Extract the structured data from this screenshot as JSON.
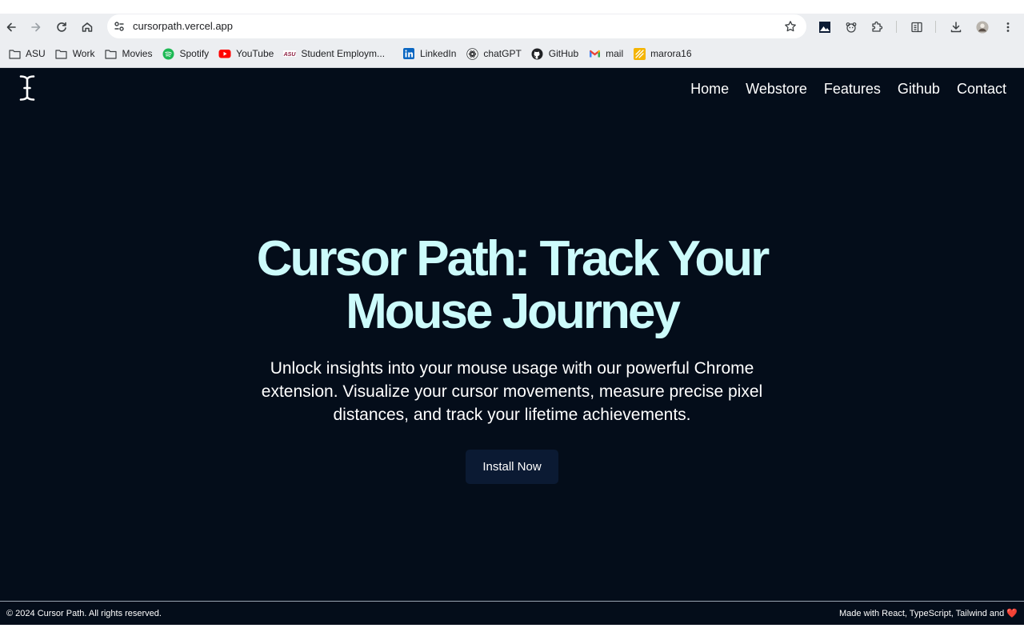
{
  "browser": {
    "url": "cursorpath.vercel.app",
    "bookmarks": [
      {
        "label": "ASU",
        "icon": "folder-icon"
      },
      {
        "label": "Work",
        "icon": "folder-icon"
      },
      {
        "label": "Movies",
        "icon": "folder-icon"
      },
      {
        "label": "Spotify",
        "icon": "spotify-icon",
        "color": "#1db954"
      },
      {
        "label": "YouTube",
        "icon": "youtube-icon",
        "color": "#ff0000"
      },
      {
        "label": "Student Employm...",
        "icon": "asu-icon",
        "color": "#8c1d40"
      },
      {
        "label": "LinkedIn",
        "icon": "linkedin-icon",
        "color": "#0a66c2"
      },
      {
        "label": "chatGPT",
        "icon": "chatgpt-icon"
      },
      {
        "label": "GitHub",
        "icon": "github-icon"
      },
      {
        "label": "mail",
        "icon": "gmail-icon",
        "color": "#ea4335"
      },
      {
        "label": "marora16",
        "icon": "marora-icon",
        "color": "#f4b400"
      }
    ]
  },
  "site": {
    "nav": [
      "Home",
      "Webstore",
      "Features",
      "Github",
      "Contact"
    ],
    "hero": {
      "title": "Cursor Path: Track Your Mouse Journey",
      "subtitle": "Unlock insights into your mouse usage with our powerful Chrome extension. Visualize your cursor movements, measure precise pixel distances, and track your lifetime achievements.",
      "cta": "Install Now"
    },
    "footer": {
      "copyright": "© 2024 Cursor Path. All rights reserved.",
      "made_with": "Made with React, TypeScript, Tailwind and"
    }
  },
  "colors": {
    "page_bg": "#040d1a",
    "title": "#ccfbfb",
    "button_bg": "#0b1a33",
    "heart": "#e53935"
  }
}
